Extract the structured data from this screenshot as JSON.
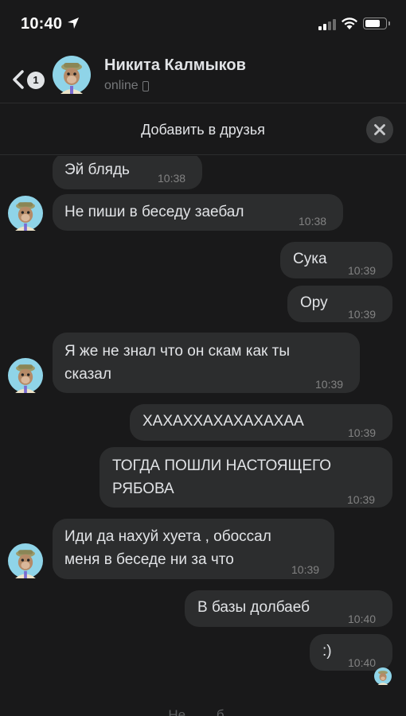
{
  "status_bar": {
    "time": "10:40",
    "battery_level": 0.75
  },
  "header": {
    "back_badge": "1",
    "contact_name": "Никита Калмыков",
    "contact_status": "online"
  },
  "add_friend_bar": {
    "label": "Добавить в друзья"
  },
  "messages": [
    {
      "direction": "in",
      "text": "Эй блядь",
      "time": "10:38"
    },
    {
      "direction": "in",
      "text": "Не пиши в беседу заебал",
      "time": "10:38"
    },
    {
      "direction": "out",
      "text": "Сука",
      "time": "10:39"
    },
    {
      "direction": "out",
      "text": "Ору",
      "time": "10:39"
    },
    {
      "direction": "in",
      "text": "Я же не знал что он скам как ты сказал",
      "lines": [
        "Я же не знал что он скам как ты",
        "сказал"
      ],
      "time": "10:39"
    },
    {
      "direction": "out",
      "text": "ХАХАХХАХАХАХАХАА",
      "time": "10:39"
    },
    {
      "direction": "out",
      "text": "ТОГДА ПОШЛИ НАСТОЯЩЕГО РЯБОВА",
      "lines": [
        "ТОГДА ПОШЛИ НАСТОЯЩЕГО",
        "РЯБОВА"
      ],
      "time": "10:39"
    },
    {
      "direction": "in",
      "text": "Иди да нахуй хуета , обоссал меня в беседе ни за что",
      "lines": [
        "Иди да нахуй хуета , обоссал",
        "меня в беседе ни за что"
      ],
      "time": "10:39"
    },
    {
      "direction": "out",
      "text": "В базы долбаеб",
      "time": "10:40"
    },
    {
      "direction": "out",
      "text": ":)",
      "time": "10:40"
    }
  ],
  "footer": {
    "text": "Не…  …б…"
  },
  "icons": {
    "location": "location-arrow-icon",
    "signal": "cellular-signal-icon",
    "wifi": "wifi-icon",
    "battery": "battery-icon",
    "back": "chevron-left-icon",
    "close": "close-icon",
    "device": "mobile-device-icon"
  }
}
